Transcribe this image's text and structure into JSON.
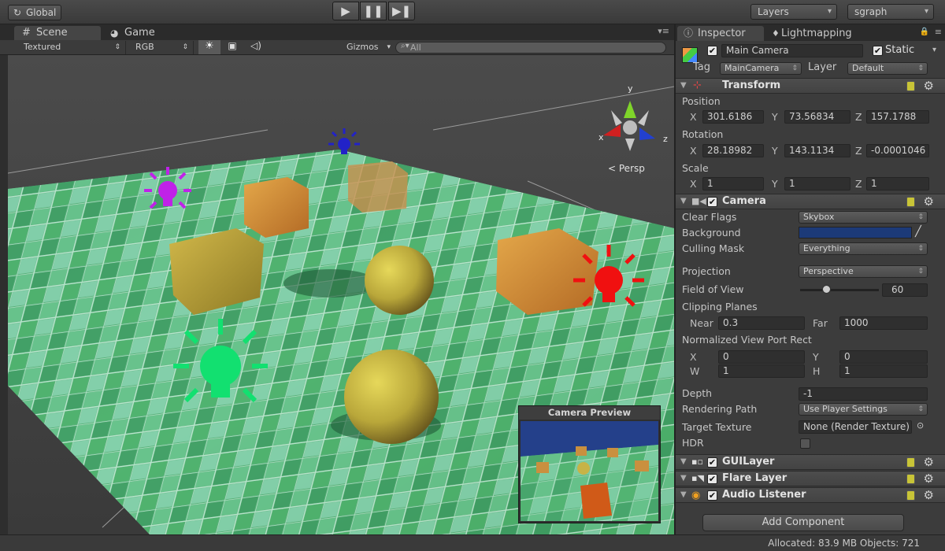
{
  "toolbar": {
    "global_label": "Global",
    "layers_label": "Layers",
    "layout_label": "sgraph"
  },
  "scene": {
    "tab_scene": "Scene",
    "tab_game": "Game",
    "shading_mode": "Textured",
    "render_mode": "RGB",
    "gizmos_label": "Gizmos",
    "search_placeholder": "All",
    "persp_label": "Persp",
    "gizmo_axis_x": "x",
    "gizmo_axis_y": "y",
    "gizmo_axis_z": "z",
    "camera_preview_title": "Camera Preview"
  },
  "inspector": {
    "tab_inspector": "Inspector",
    "tab_lightmapping": "Lightmapping",
    "object_name": "Main Camera",
    "static_label": "Static",
    "tag_label": "Tag",
    "tag_value": "MainCamera",
    "layer_label": "Layer",
    "layer_value": "Default",
    "transform": {
      "title": "Transform",
      "position_label": "Position",
      "position": {
        "x": "301.6186",
        "y": "73.56834",
        "z": "157.1788"
      },
      "rotation_label": "Rotation",
      "rotation": {
        "x": "28.18982",
        "y": "143.1134",
        "z": "-0.0001046"
      },
      "scale_label": "Scale",
      "scale": {
        "x": "1",
        "y": "1",
        "z": "1"
      },
      "axis_x": "X",
      "axis_y": "Y",
      "axis_z": "Z"
    },
    "camera": {
      "title": "Camera",
      "clear_flags_label": "Clear Flags",
      "clear_flags_value": "Skybox",
      "background_label": "Background",
      "background_color": "#1c3a78",
      "culling_mask_label": "Culling Mask",
      "culling_mask_value": "Everything",
      "projection_label": "Projection",
      "projection_value": "Perspective",
      "fov_label": "Field of View",
      "fov_value": "60",
      "fov_fraction": 0.33,
      "clipping_label": "Clipping Planes",
      "near_label": "Near",
      "near_value": "0.3",
      "far_label": "Far",
      "far_value": "1000",
      "viewport_label": "Normalized View Port Rect",
      "vp_x_label": "X",
      "vp_x": "0",
      "vp_y_label": "Y",
      "vp_y": "0",
      "vp_w_label": "W",
      "vp_w": "1",
      "vp_h_label": "H",
      "vp_h": "1",
      "depth_label": "Depth",
      "depth_value": "-1",
      "rendering_path_label": "Rendering Path",
      "rendering_path_value": "Use Player Settings",
      "target_texture_label": "Target Texture",
      "target_texture_value": "None (Render Texture)",
      "hdr_label": "HDR"
    },
    "gui_layer_title": "GUILayer",
    "flare_layer_title": "Flare Layer",
    "audio_listener_title": "Audio Listener",
    "add_component_label": "Add Component"
  },
  "status": {
    "text": "Allocated: 83.9 MB Objects: 721"
  }
}
